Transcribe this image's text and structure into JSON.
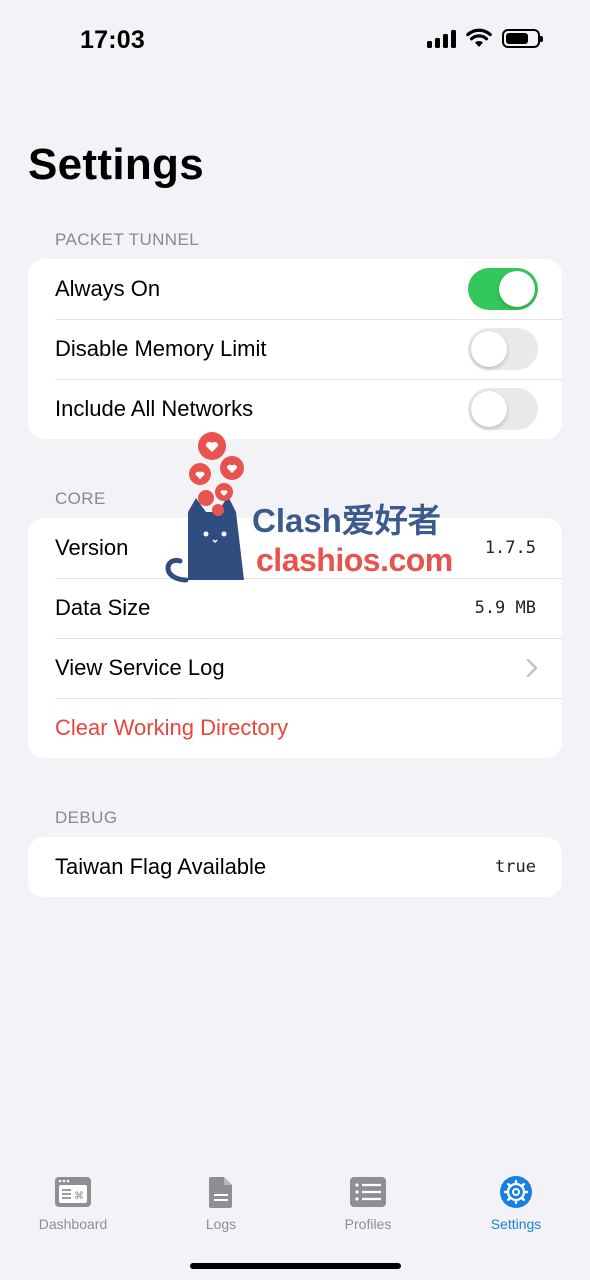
{
  "status_bar": {
    "time": "17:03"
  },
  "page": {
    "title": "Settings"
  },
  "sections": {
    "packet_tunnel": {
      "header": "PACKET TUNNEL",
      "rows": [
        {
          "label": "Always On",
          "toggle": true
        },
        {
          "label": "Disable Memory Limit",
          "toggle": false
        },
        {
          "label": "Include All Networks",
          "toggle": false
        }
      ]
    },
    "core": {
      "header": "CORE",
      "rows": [
        {
          "label": "Version",
          "value": "1.7.5"
        },
        {
          "label": "Data Size",
          "value": "5.9 MB"
        },
        {
          "label": "View Service Log",
          "icon": "chevron-right-icon"
        },
        {
          "label": "Clear Working Directory",
          "destructive_color": "#e8453c"
        }
      ]
    },
    "debug": {
      "header": "DEBUG",
      "rows": [
        {
          "label": "Taiwan Flag Available",
          "value": "true"
        }
      ]
    }
  },
  "watermark": {
    "title": "Clash爱好者",
    "url": "clashios.com"
  },
  "tab_bar": {
    "tabs": [
      {
        "label": "Dashboard",
        "icon": "terminal-window-icon",
        "active": false
      },
      {
        "label": "Logs",
        "icon": "document-icon",
        "active": false
      },
      {
        "label": "Profiles",
        "icon": "list-icon",
        "active": false
      },
      {
        "label": "Settings",
        "icon": "gear-icon",
        "active": true
      }
    ],
    "active_color": "#1a7fe0",
    "inactive_color": "#8e8e93"
  },
  "colors": {
    "background": "#f2f2f7",
    "toggle_on": "#34c759",
    "toggle_off": "#e9e9ea"
  }
}
